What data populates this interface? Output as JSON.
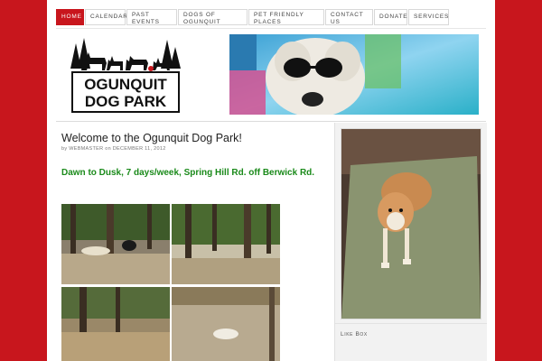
{
  "nav": {
    "items": [
      {
        "label": "HOME",
        "active": true
      },
      {
        "label": "CALENDAR"
      },
      {
        "label": "PAST EVENTS"
      },
      {
        "label": "DOGS OF OGUNQUIT"
      },
      {
        "label": "PET FRIENDLY PLACES"
      },
      {
        "label": "CONTACT US"
      },
      {
        "label": "DONATE"
      },
      {
        "label": "SERVICES"
      }
    ]
  },
  "logo": {
    "line1": "OGUNQUIT",
    "line2": "DOG PARK"
  },
  "post": {
    "title": "Welcome to the Ogunquit Dog Park!",
    "meta_by": "by",
    "author": "WEBMASTER",
    "meta_on": "on",
    "date": "DECEMBER 11, 2012",
    "hours": "Dawn to Dusk, 7 days/week, Spring Hill Rd. off Berwick Rd."
  },
  "sidebar": {
    "like_box": "Like Box"
  },
  "colors": {
    "brand": "#c8161d",
    "hours_green": "#1a8a1a"
  }
}
